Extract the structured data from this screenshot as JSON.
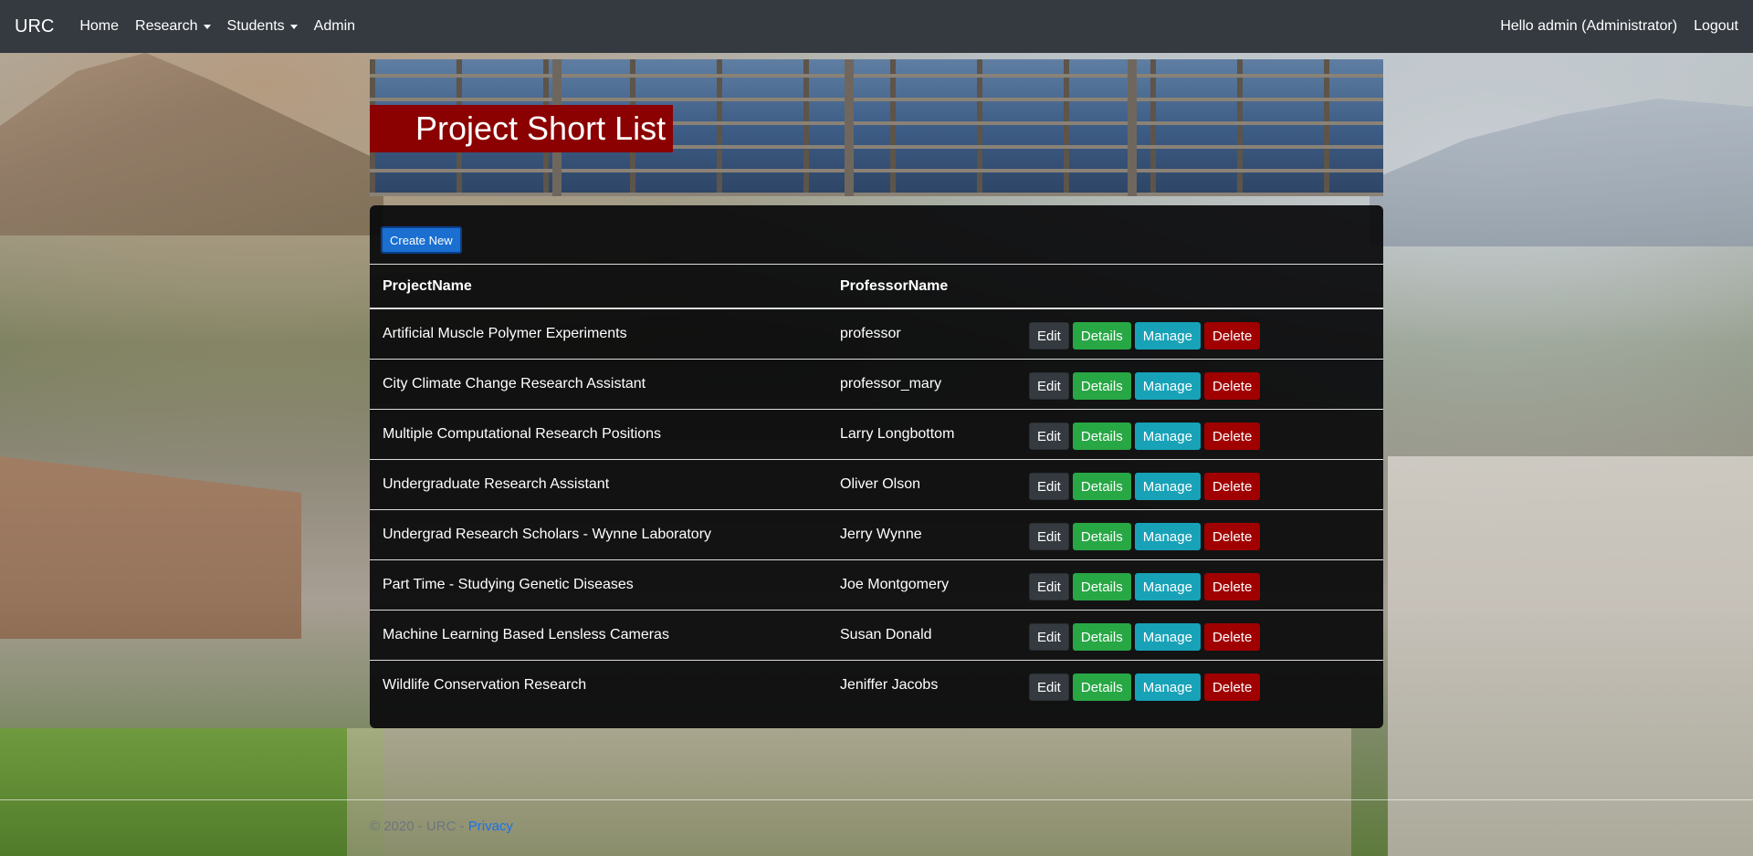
{
  "navbar": {
    "brand": "URC",
    "links": [
      {
        "label": "Home"
      },
      {
        "label": "Research"
      },
      {
        "label": "Students"
      },
      {
        "label": "Admin"
      }
    ],
    "greeting": "Hello admin (Administrator)",
    "logout": "Logout"
  },
  "banner": {
    "title": "Project Short List"
  },
  "actions": {
    "create_new": "Create New"
  },
  "table": {
    "headers": {
      "project": "ProjectName",
      "professor": "ProfessorName"
    },
    "row_buttons": {
      "edit": "Edit",
      "details": "Details",
      "manage": "Manage",
      "delete": "Delete"
    },
    "rows": [
      {
        "project": "Artificial Muscle Polymer Experiments",
        "professor": "professor"
      },
      {
        "project": "City Climate Change Research Assistant",
        "professor": "professor_mary"
      },
      {
        "project": "Multiple Computational Research Positions",
        "professor": "Larry Longbottom"
      },
      {
        "project": "Undergraduate Research Assistant",
        "professor": "Oliver Olson"
      },
      {
        "project": "Undergrad Research Scholars - Wynne Laboratory",
        "professor": "Jerry Wynne"
      },
      {
        "project": "Part Time - Studying Genetic Diseases",
        "professor": "Joe Montgomery"
      },
      {
        "project": "Machine Learning Based Lensless Cameras",
        "professor": "Susan Donald"
      },
      {
        "project": "Wildlife Conservation Research",
        "professor": "Jeniffer Jacobs"
      }
    ]
  },
  "footer": {
    "copyright": "© 2020 - URC - ",
    "privacy": "Privacy"
  },
  "colors": {
    "navbar": "#343a40",
    "banner_title_bg": "#8b0000",
    "create_button": "#1a6fd1",
    "details": "#28a745",
    "manage": "#17a2b8",
    "delete": "#a00000",
    "privacy_link": "#1a73e8"
  }
}
